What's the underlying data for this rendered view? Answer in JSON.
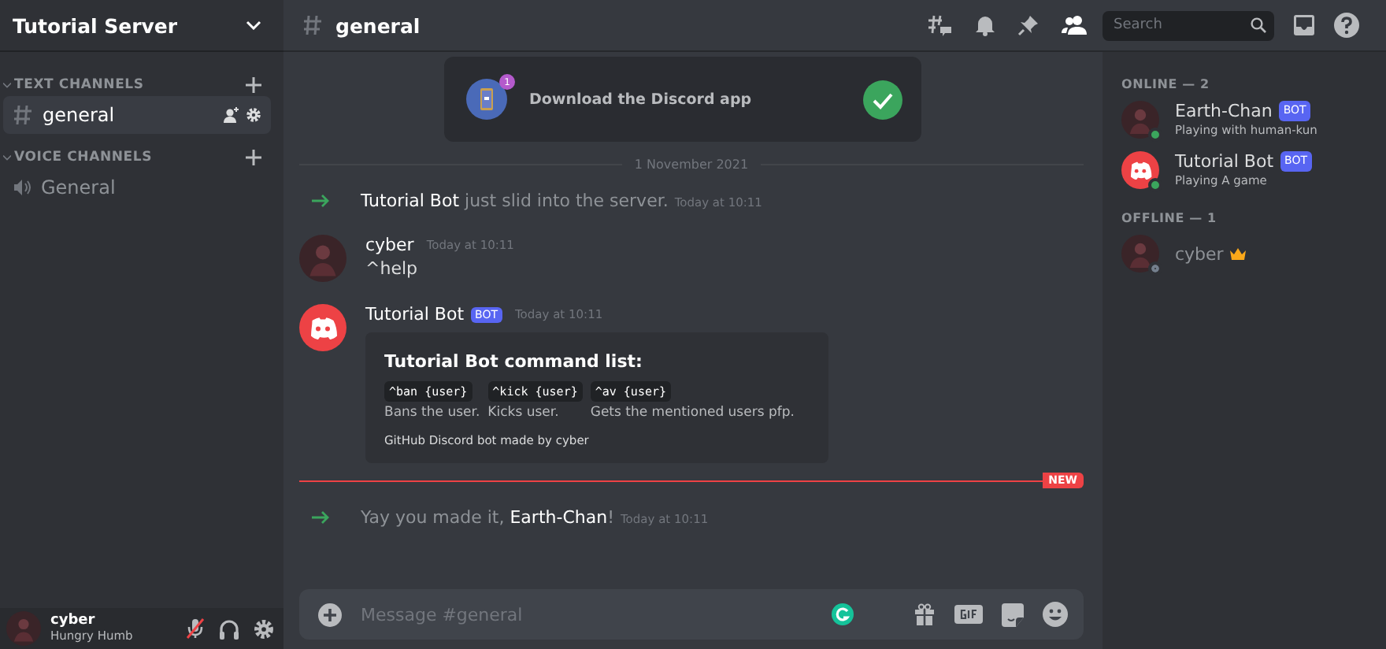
{
  "sidebar": {
    "server_name": "Tutorial Server",
    "categories": [
      {
        "name": "TEXT CHANNELS",
        "expanded": true,
        "channels": [
          {
            "name": "general",
            "kind": "text",
            "selected": true
          }
        ]
      },
      {
        "name": "VOICE CHANNELS",
        "expanded": true,
        "channels": [
          {
            "name": "General",
            "kind": "voice",
            "selected": false
          }
        ]
      }
    ],
    "user": {
      "name": "cyber",
      "status": "Hungry Humb",
      "muted": true
    }
  },
  "header": {
    "channel": "general",
    "search": {
      "placeholder": "Search"
    }
  },
  "banner": {
    "text": "Download the Discord app",
    "badge": "1",
    "done": true
  },
  "date_divider": "1 November 2021",
  "messages": [
    {
      "kind": "system",
      "text": "**Tutorial Bot** just slid into the server.",
      "time": "Today at 10:11"
    },
    {
      "kind": "user",
      "author": "cyber",
      "time": "Today at 10:11",
      "text": "^help"
    },
    {
      "kind": "user",
      "author": "Tutorial Bot",
      "bot_tag": "BOT",
      "time": "Today at 10:11",
      "embed": {
        "title": "Tutorial Bot command list:",
        "fields": [
          {
            "code": "^ban {user}",
            "text": "Bans the user."
          },
          {
            "code": "^kick {user}",
            "text": "Kicks user."
          },
          {
            "code": "^av {user}",
            "text": "Gets the mentioned users pfp."
          }
        ],
        "footer": "GitHub Discord bot made by cyber"
      }
    },
    {
      "kind": "new_divider",
      "label": "NEW"
    },
    {
      "kind": "system",
      "text": "Yay you made it, **Earth-Chan**!",
      "time": "Today at 10:11"
    }
  ],
  "composer": {
    "placeholder": "Message #general"
  },
  "members": [
    {
      "title": "ONLINE — 2",
      "members": [
        {
          "name": "Earth-Chan",
          "kind": "person",
          "bot_tag": "BOT",
          "activity": "Playing with human-kun",
          "online": true
        },
        {
          "name": "Tutorial Bot",
          "kind": "bot",
          "bot_tag": "BOT",
          "activity": "Playing A game",
          "online": true
        }
      ]
    },
    {
      "title": "OFFLINE — 1",
      "members": [
        {
          "name": "cyber",
          "kind": "person",
          "owner": true,
          "online": false
        }
      ]
    }
  ]
}
